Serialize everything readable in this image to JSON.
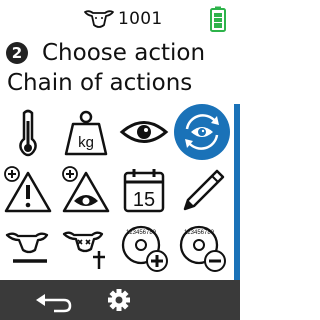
{
  "status": {
    "cow_icon": "cow-head-icon",
    "animal_number": "1001",
    "battery_icon": "battery-icon",
    "battery_level": 0.8,
    "battery_color": "#2db34a"
  },
  "header": {
    "step_number": "2",
    "title": "Choose action",
    "subtitle": "Chain of actions"
  },
  "actions": [
    {
      "icon": "thermometer-icon"
    },
    {
      "icon": "weight-kg-icon",
      "label": "kg"
    },
    {
      "icon": "eye-icon"
    },
    {
      "icon": "eye-cycle-icon",
      "selected": true
    },
    {
      "icon": "warning-add-icon"
    },
    {
      "icon": "eye-warning-add-icon"
    },
    {
      "icon": "calendar-icon",
      "label": "15"
    },
    {
      "icon": "pencil-icon"
    },
    {
      "icon": "cow-remove-icon"
    },
    {
      "icon": "cow-dead-icon"
    },
    {
      "icon": "tag-add-icon",
      "label": "123456789"
    },
    {
      "icon": "tag-remove-icon",
      "label": "123456789"
    }
  ],
  "bottom_bar": {
    "back_icon": "back-arrow-icon",
    "settings_icon": "gear-icon"
  },
  "colors": {
    "accent": "#1a72b8",
    "bottom_bar": "#3a3a3a",
    "battery": "#2db34a"
  }
}
